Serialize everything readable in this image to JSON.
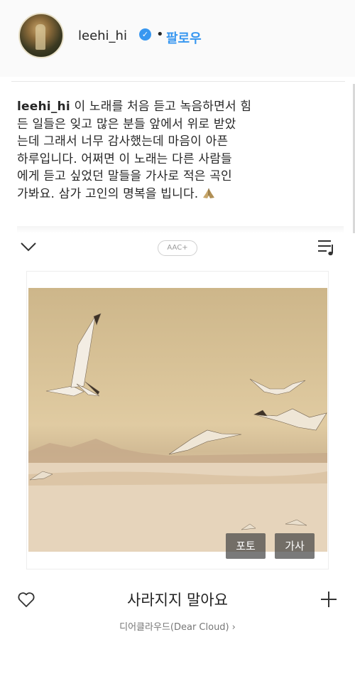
{
  "header": {
    "username": "leehi_hi",
    "separator": "•",
    "follow_label": "팔로우",
    "verified_mark": "✓"
  },
  "caption": {
    "username": "leehi_hi",
    "lines": [
      " 이 노래를 처음 듣고 녹음하면서 힘",
      "든 일들은 잊고 많은 분들 앞에서 위로 받았",
      "는데 그래서 너무 감사했는데 마음이 아픈",
      "하루입니다. 어쩌면 이 노래는 다른 사람들",
      "에게 듣고 싶었던 말들을 가사로 적은 곡인",
      "가봐요. 삼가 고인의 명복을 빕니다."
    ],
    "emoji_icon": "folded-hands-icon"
  },
  "player": {
    "codec_badge": "AAC+",
    "tag_photo": "포토",
    "tag_lyrics": "가사",
    "song_title": "사라지지 말아요",
    "artist": "디어클라우드(Dear Cloud)",
    "artist_arrow": "›"
  },
  "icons": {
    "collapse": "chevron-down-icon",
    "playlist": "playlist-icon",
    "like": "heart-icon",
    "add": "plus-icon"
  },
  "colors": {
    "link_blue": "#3897f0",
    "text": "#262626",
    "overlay_button": "#464646"
  }
}
